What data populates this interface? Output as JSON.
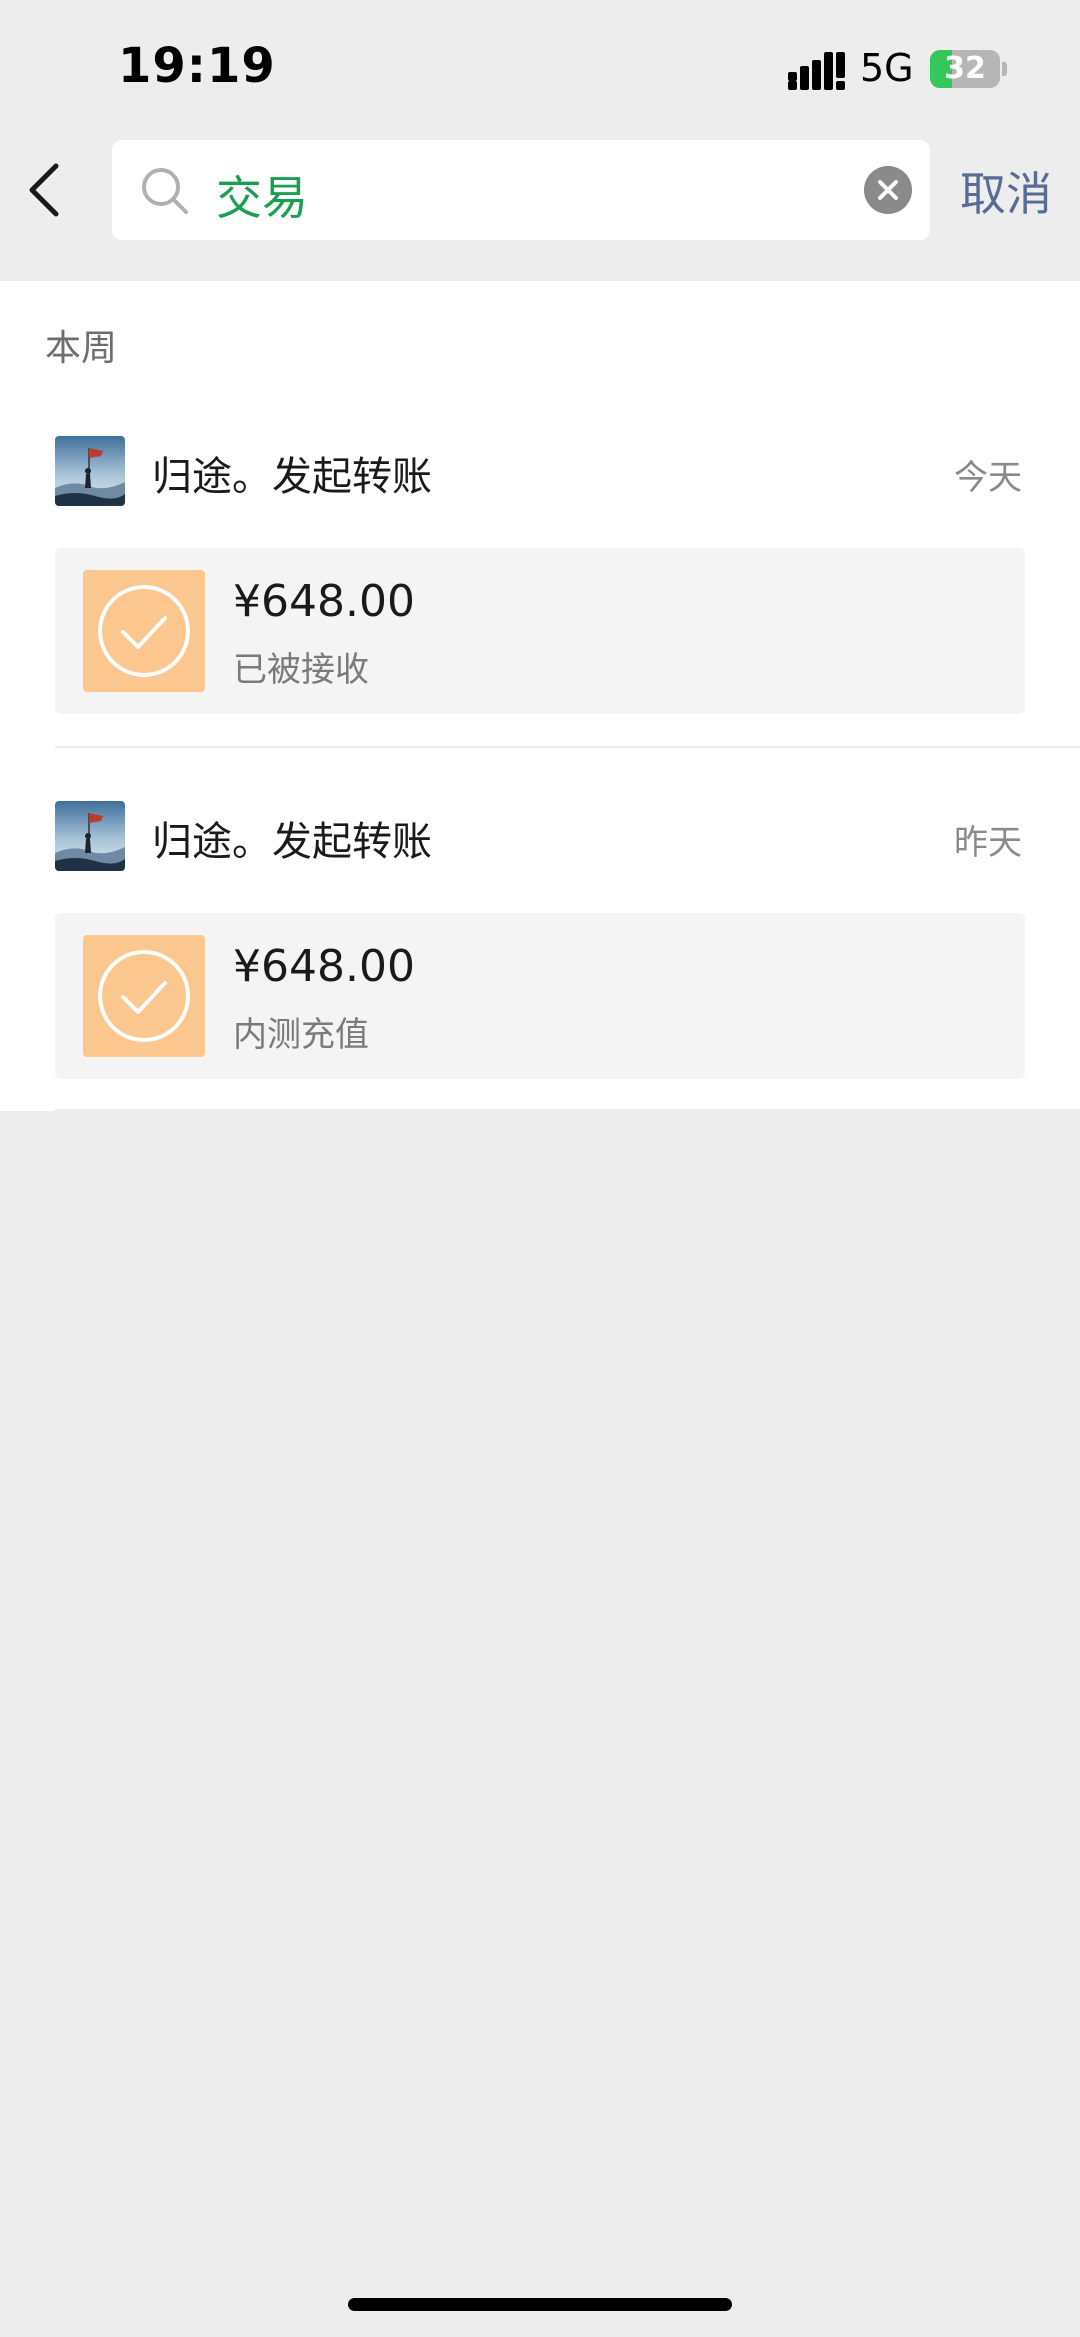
{
  "status_bar": {
    "time": "19:19",
    "network": "5G",
    "battery_percent": "32",
    "battery_level": 0.32,
    "signal_icon": "cellular-signal-icon"
  },
  "search": {
    "query": "交易",
    "cancel_label": "取消",
    "icons": {
      "back": "chevron-left-icon",
      "search": "magnifier-icon",
      "clear": "clear-x-icon"
    }
  },
  "section": {
    "label": "本周"
  },
  "results": [
    {
      "title": "归途。发起转账",
      "date": "今天",
      "amount": "¥648.00",
      "status": "已被接收"
    },
    {
      "title": "归途。发起转账",
      "date": "昨天",
      "amount": "¥648.00",
      "status": "内测充值"
    }
  ],
  "colors": {
    "search_text": "#1a9f52",
    "cancel": "#576b95",
    "transfer_icon_bg": "#fbc78e",
    "background": "#ededed"
  }
}
